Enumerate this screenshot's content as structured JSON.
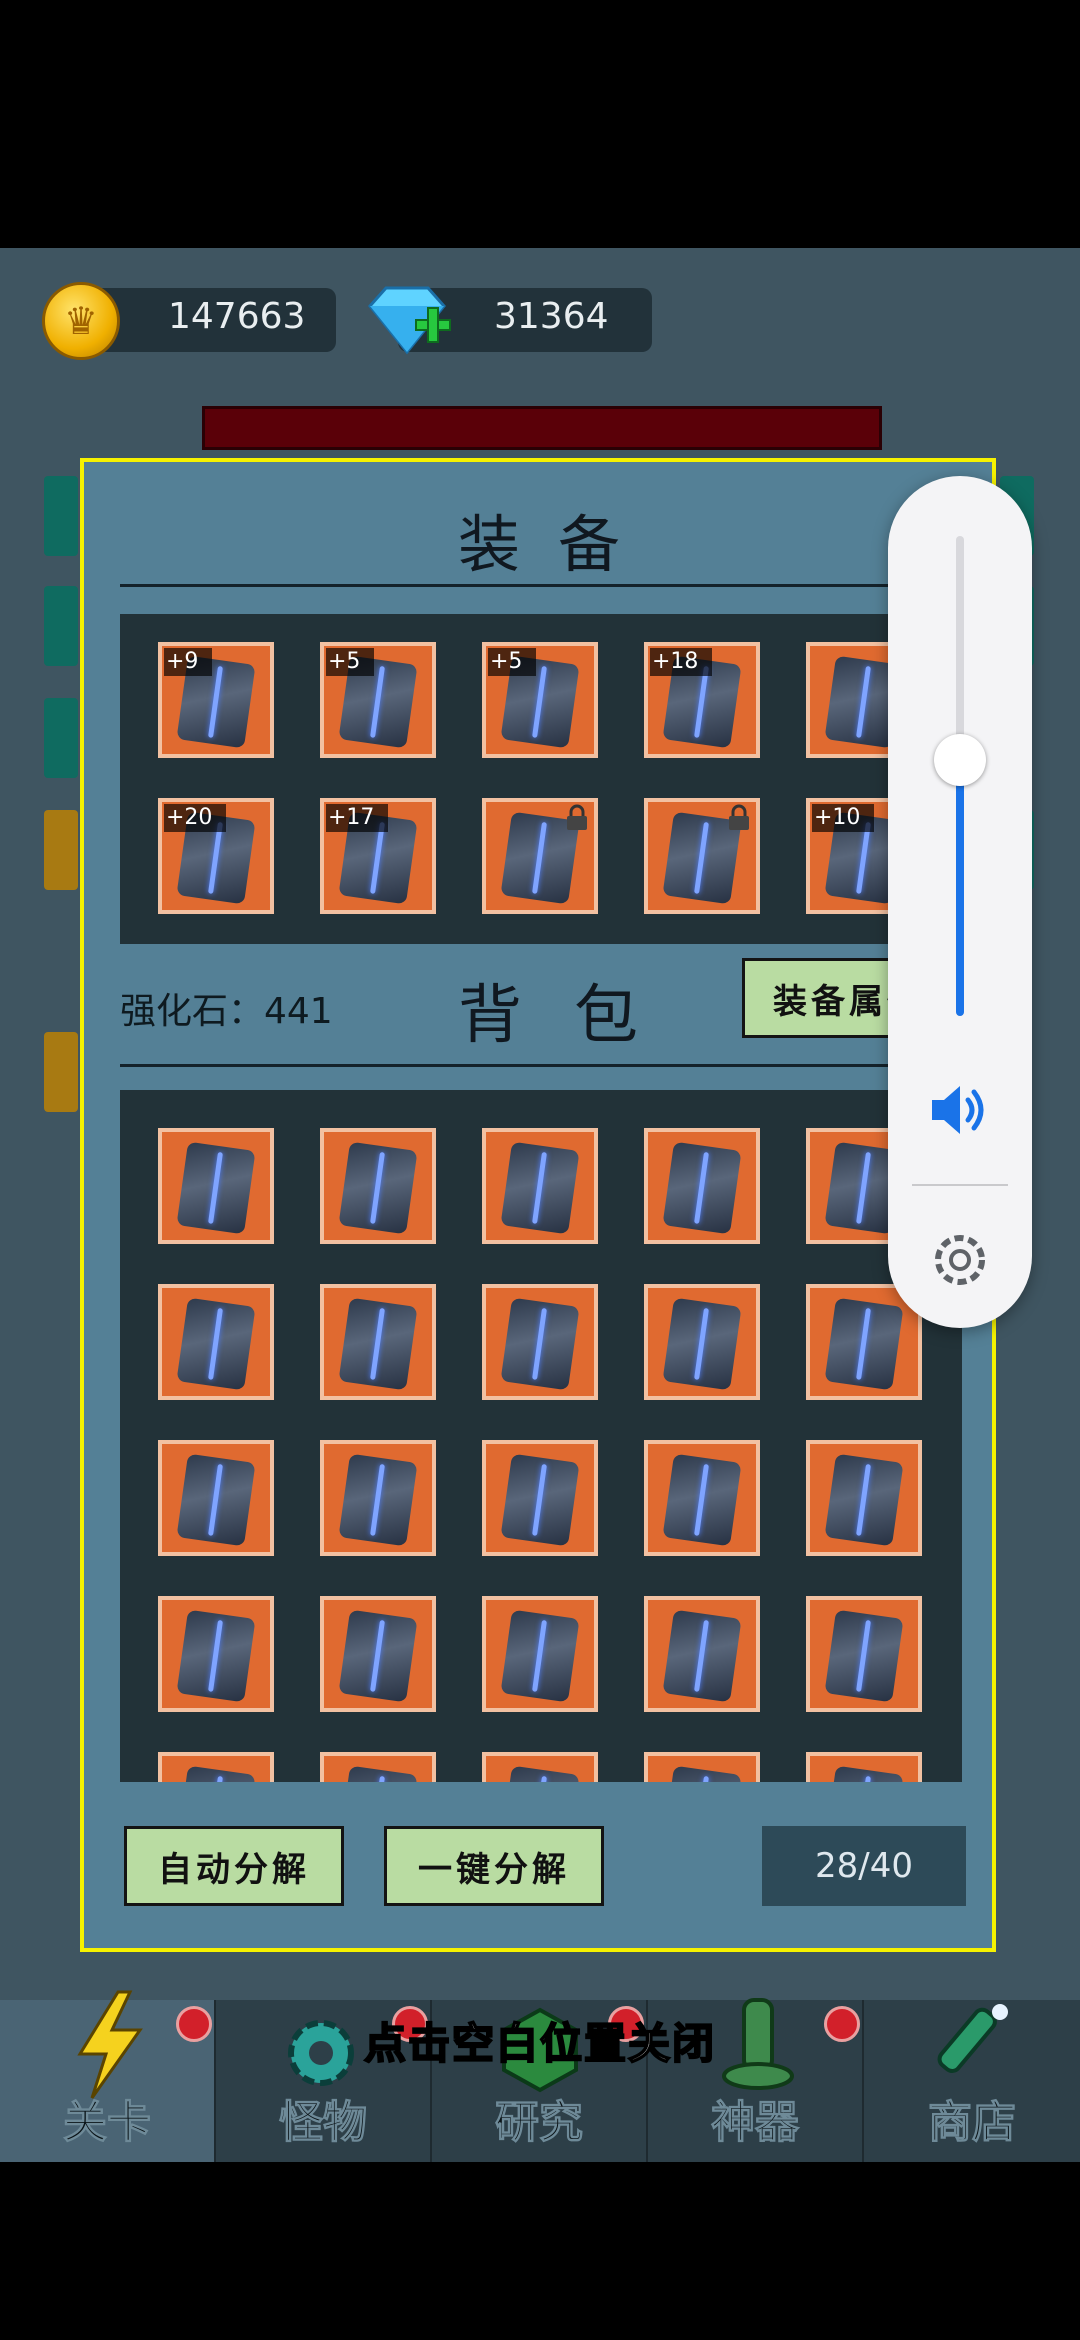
{
  "resources": {
    "gold": "147663",
    "gems": "31364"
  },
  "panel": {
    "equip_title": "装备",
    "bag_title": "背包",
    "stone_label": "强化石：441",
    "attr_button": "装备属性",
    "equipped_slots": [
      {
        "badge": "+9",
        "locked": false
      },
      {
        "badge": "+5",
        "locked": false
      },
      {
        "badge": "+5",
        "locked": false
      },
      {
        "badge": "+18",
        "locked": false
      },
      {
        "badge": "",
        "locked": false
      },
      {
        "badge": "+20",
        "locked": false
      },
      {
        "badge": "+17",
        "locked": false
      },
      {
        "badge": "",
        "locked": true
      },
      {
        "badge": "",
        "locked": true
      },
      {
        "badge": "+10",
        "locked": false
      }
    ],
    "bag_slot_rows": 5,
    "auto_decompose_button": "自动分解",
    "one_click_decompose_button": "一键分解",
    "capacity": "28/40"
  },
  "close_hint": "点击空白位置关闭",
  "nav": [
    {
      "label": "关卡",
      "icon": "lightning-icon",
      "active": true,
      "dot": true
    },
    {
      "label": "怪物",
      "icon": "gear-monster-icon",
      "active": false,
      "dot": true
    },
    {
      "label": "研究",
      "icon": "research-icon",
      "active": false,
      "dot": true
    },
    {
      "label": "神器",
      "icon": "artifact-icon",
      "active": false,
      "dot": true
    },
    {
      "label": "商店",
      "icon": "shop-icon",
      "active": false,
      "dot": false
    }
  ],
  "volume": {
    "level": 0.53
  },
  "colors": {
    "panel": "#548096",
    "border": "#f6f200",
    "slot": "#e06a30",
    "button": "#b9dca2"
  }
}
